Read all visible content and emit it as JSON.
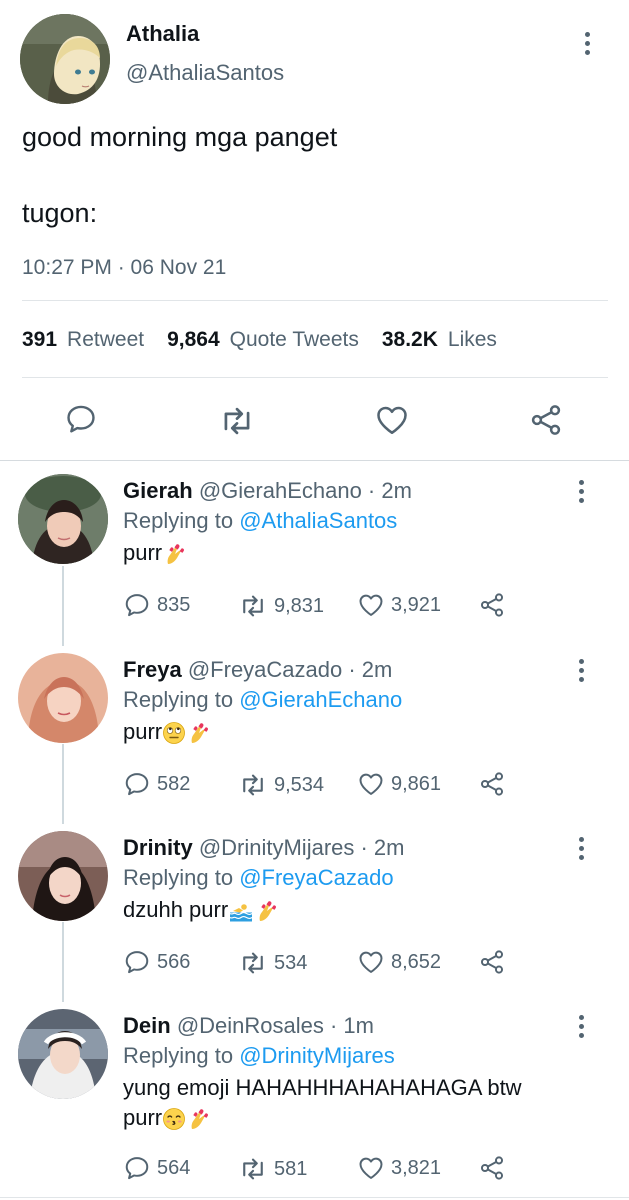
{
  "main_tweet": {
    "name": "Athalia",
    "handle": "@AthaliaSantos",
    "line1": "good morning mga panget",
    "line2": "tugon:",
    "timestamp": "10:27 PM · 06 Nov 21",
    "stats": {
      "retweets": "391",
      "retweets_label": "Retweet",
      "quotes": "9,864",
      "quotes_label": "Quote Tweets",
      "likes": "38.2K",
      "likes_label": "Likes"
    }
  },
  "replies": [
    {
      "name": "Gierah",
      "handle": "@GierahEchano · 2m",
      "replying_prefix": "Replying to",
      "replying_to": "@AthaliaSantos",
      "text": "purr",
      "emojis": [
        "nail-polish"
      ],
      "comments": "835",
      "retweets": "9,831",
      "likes": "3,921"
    },
    {
      "name": "Freya",
      "handle": "@FreyaCazado · 2m",
      "replying_prefix": "Replying to",
      "replying_to": "@GierahEchano",
      "text": "purr",
      "emojis": [
        "eye-roll-face",
        "nail-polish"
      ],
      "comments": "582",
      "retweets": "9,534",
      "likes": "9,861"
    },
    {
      "name": "Drinity",
      "handle": "@DrinityMijares · 2m",
      "replying_prefix": "Replying to",
      "replying_to": "@FreyaCazado",
      "text": "dzuhh purr",
      "emojis": [
        "swimmer",
        "nail-polish"
      ],
      "comments": "566",
      "retweets": "534",
      "likes": "8,652"
    },
    {
      "name": "Dein",
      "handle": "@DeinRosales · 1m",
      "replying_prefix": "Replying to",
      "replying_to": "@DrinityMijares",
      "text_line1": "yung emoji HAHAHHHAHAHAHAGA btw",
      "text": "purr",
      "emojis": [
        "kissing-face",
        "nail-polish"
      ],
      "comments": "564",
      "retweets": "581",
      "likes": "3,821"
    }
  ],
  "colors": {
    "link": "#1d9bf0",
    "secondary_text": "#536471",
    "primary_text": "#0f1419",
    "divider": "#e1e5e8"
  }
}
